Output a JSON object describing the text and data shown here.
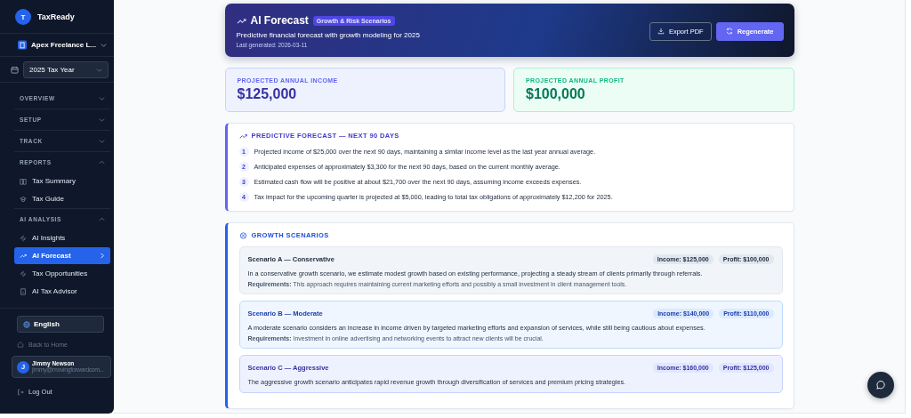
{
  "sidebar": {
    "logo_letter": "T",
    "app_name": "TaxReady",
    "company": "Apex Freelance L...",
    "tax_year": "2025 Tax Year",
    "sections": [
      {
        "title": "OVERVIEW",
        "expanded": false
      },
      {
        "title": "SETUP",
        "expanded": false
      },
      {
        "title": "TRACK",
        "expanded": false
      },
      {
        "title": "REPORTS",
        "expanded": true,
        "items": [
          {
            "label": "Tax Summary",
            "selected": false
          },
          {
            "label": "Tax Guide",
            "selected": false
          }
        ]
      },
      {
        "title": "AI ANALYSIS",
        "expanded": true,
        "items": [
          {
            "label": "AI Insights",
            "selected": false
          },
          {
            "label": "AI Forecast",
            "selected": true
          },
          {
            "label": "Tax Opportunities",
            "selected": false
          },
          {
            "label": "AI Tax Advisor",
            "selected": false
          }
        ]
      }
    ],
    "language": "English",
    "back_link": "Back to Home",
    "user": {
      "initial": "J",
      "name": "Jimmy Newson",
      "email": "jimmy@movingforwardcom..."
    },
    "logout": "Log Out"
  },
  "header": {
    "title": "AI Forecast",
    "badge": "Growth & Risk Scenarios",
    "subtitle": "Predictive financial forecast with growth modeling for 2025",
    "last_generated": "Last generated: 2026-03-11",
    "buttons": [
      "Export PDF",
      "Regenerate"
    ]
  },
  "stats": [
    {
      "kind": "income",
      "label": "PROJECTED ANNUAL INCOME",
      "value": "$125,000"
    },
    {
      "kind": "profit",
      "label": "PROJECTED ANNUAL PROFIT",
      "value": "$100,000"
    }
  ],
  "forecast": {
    "title": "PREDICTIVE FORECAST — NEXT 90 DAYS",
    "items": [
      {
        "number": "1",
        "text": "Projected income of $25,000 over the next 90 days, maintaining a similar income level as the last year annual average."
      },
      {
        "number": "2",
        "text": "Anticipated expenses of approximately $3,300 for the next 90 days, based on the current monthly average."
      },
      {
        "number": "3",
        "text": "Estimated cash flow will be positive at about $21,700 over the next 90 days, assuming income exceeds expenses."
      },
      {
        "number": "4",
        "text": "Tax impact for the upcoming quarter is projected at $5,000, leading to total tax obligations of approximately $12,200 for 2025."
      }
    ]
  },
  "growth": {
    "title": "GROWTH SCENARIOS",
    "scenarios": [
      {
        "kind": "conservative",
        "title": "Scenario A — Conservative",
        "income": "Income: $125,000",
        "profit": "Profit: $100,000",
        "description": "In a conservative growth scenario, we estimate modest growth based on existing performance, projecting a steady stream of clients primarily through referrals.",
        "requirements": "**Requirements:** This approach requires maintaining current marketing efforts and possibly a small investment in client management tools."
      },
      {
        "kind": "moderate",
        "title": "Scenario B — Moderate",
        "income": "Income: $140,000",
        "profit": "Profit: $110,000",
        "description": "A moderate scenario considers an increase in income driven by targeted marketing efforts and expansion of services, while still being cautious about expenses.",
        "requirements": "**Requirements:** Investment in online advertising and networking events to attract new clients will be crucial."
      },
      {
        "kind": "aggressive",
        "title": "Scenario C — Aggressive",
        "income": "Income: $160,000",
        "profit": "Profit: $125,000",
        "description": "The aggressive growth scenario anticipates rapid revenue growth through diversification of services and premium pricing strategies."
      }
    ]
  }
}
